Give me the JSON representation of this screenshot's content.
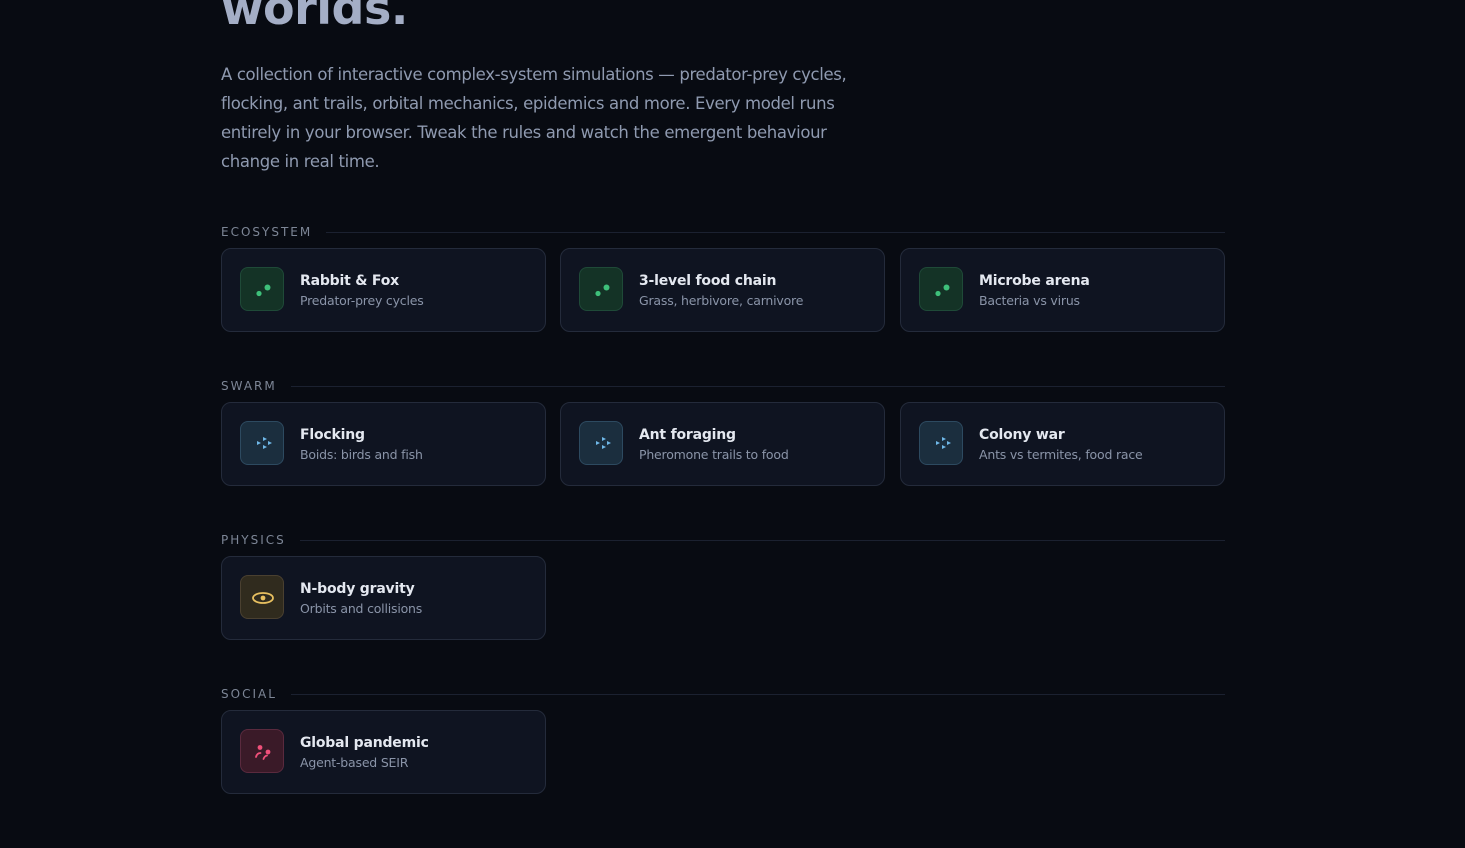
{
  "hero": {
    "title": "worlds.",
    "description": "A collection of interactive complex-system simulations — predator-prey cycles, flocking, ant trails, orbital mechanics, epidemics and more. Every model runs entirely in your browser. Tweak the rules and watch the emergent behaviour change in real time."
  },
  "colors": {
    "background": "#080b12",
    "card": "#0f1421",
    "ecosystem_accent": "#3ec07a",
    "swarm_accent": "#6fb8e8",
    "physics_accent": "#e8c060",
    "social_accent": "#f0507a"
  },
  "sections": [
    {
      "label": "ECOSYSTEM",
      "icon": "dots-icon",
      "cards": [
        {
          "title": "Rabbit & Fox",
          "subtitle": "Predator-prey cycles"
        },
        {
          "title": "3-level food chain",
          "subtitle": "Grass, herbivore, carnivore"
        },
        {
          "title": "Microbe arena",
          "subtitle": "Bacteria vs virus"
        }
      ]
    },
    {
      "label": "SWARM",
      "icon": "arrows-icon",
      "cards": [
        {
          "title": "Flocking",
          "subtitle": "Boids: birds and fish"
        },
        {
          "title": "Ant foraging",
          "subtitle": "Pheromone trails to food"
        },
        {
          "title": "Colony war",
          "subtitle": "Ants vs termites, food race"
        }
      ]
    },
    {
      "label": "PHYSICS",
      "icon": "orbit-icon",
      "cards": [
        {
          "title": "N-body gravity",
          "subtitle": "Orbits and collisions"
        }
      ]
    },
    {
      "label": "SOCIAL",
      "icon": "people-icon",
      "cards": [
        {
          "title": "Global pandemic",
          "subtitle": "Agent-based SEIR"
        }
      ]
    }
  ]
}
